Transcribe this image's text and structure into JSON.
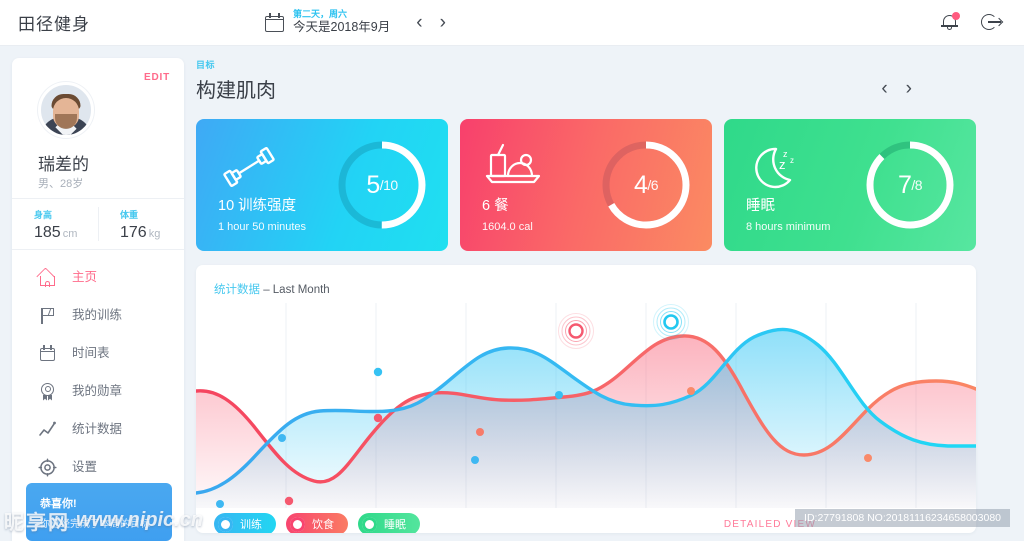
{
  "header": {
    "brand": "田径健身",
    "calendar_icon": "calendar-icon",
    "date_sub": "第二天，周六",
    "date_main": "今天是2018年9月",
    "prev": "‹",
    "next": "›",
    "bell_icon": "bell-icon",
    "logout_icon": "logout-icon"
  },
  "sidebar": {
    "edit_label": "EDIT",
    "user_name": "瑞差的",
    "user_meta": "男、28岁",
    "metrics": [
      {
        "label": "身高",
        "value": "185",
        "unit": "cm"
      },
      {
        "label": "体重",
        "value": "176",
        "unit": "kg"
      }
    ],
    "nav": [
      {
        "label": "主页",
        "icon": "home-icon",
        "active": true
      },
      {
        "label": "我的训练",
        "icon": "flag-icon",
        "active": false
      },
      {
        "label": "时间表",
        "icon": "calendar-icon",
        "active": false
      },
      {
        "label": "我的勋章",
        "icon": "medal-icon",
        "active": false
      },
      {
        "label": "统计数据",
        "icon": "line-chart-icon",
        "active": false
      },
      {
        "label": "设置",
        "icon": "gear-icon",
        "active": false
      }
    ],
    "promo": {
      "title": "恭喜你!",
      "sub": "你已经完成了本周的目标"
    }
  },
  "main": {
    "goal_kicker": "目标",
    "goal_title": "构建肌肉",
    "prev": "‹",
    "next": "›",
    "cards": [
      {
        "icon": "dumbbell-icon",
        "title": "10 训练强度",
        "subtitle": "1 hour 50 minutes",
        "value": "5",
        "total": "/10",
        "progress": 0.5,
        "color": "#22d3f5"
      },
      {
        "icon": "meal-icon",
        "title": "6 餐",
        "subtitle": "1604.0 cal",
        "value": "4",
        "total": "/6",
        "progress": 0.667,
        "color": "#fa6a67"
      },
      {
        "icon": "moon-sleep-icon",
        "title": "睡眠",
        "subtitle": "8 hours minimum",
        "value": "7",
        "total": "/8",
        "progress": 0.875,
        "color": "#3fe08f"
      }
    ]
  },
  "panel": {
    "title_hi": "统计数据",
    "title_rest": " – Last Month",
    "detailed_view": "DETAILED VIEW",
    "legend": [
      {
        "label": "训练",
        "color": "#37b6f2"
      },
      {
        "label": "饮食",
        "color": "#f8456f"
      },
      {
        "label": "睡眠",
        "color": "#2fd98a"
      }
    ]
  },
  "chart_data": {
    "type": "area",
    "title": "统计数据 – Last Month",
    "xlabel": "",
    "ylabel": "",
    "grid": "vertical",
    "legend_position": "bottom-left",
    "x": [
      0,
      1,
      2,
      3,
      4,
      5,
      6,
      7,
      8,
      9,
      10
    ],
    "ylim": [
      0,
      100
    ],
    "series": [
      {
        "name": "训练",
        "color": "#37b6f2",
        "values": [
          8,
          30,
          45,
          44,
          70,
          78,
          60,
          40,
          44,
          62,
          96,
          42,
          28
        ]
      },
      {
        "name": "饮食",
        "color": "#f8456f",
        "values": [
          55,
          40,
          12,
          14,
          34,
          58,
          62,
          60,
          56,
          52,
          80,
          24,
          20
        ]
      }
    ],
    "markers": [
      {
        "series": "训练",
        "x": 1.0,
        "y": 46
      },
      {
        "series": "训练",
        "x": 2.4,
        "y": 72
      },
      {
        "series": "训练",
        "x": 4.1,
        "y": 36
      },
      {
        "series": "训练",
        "x": 5.4,
        "y": 56
      },
      {
        "series": "训练",
        "x": 6.4,
        "y": 40
      },
      {
        "series": "饮食",
        "x": 1.1,
        "y": 10
      },
      {
        "series": "饮食",
        "x": 2.4,
        "y": 58
      },
      {
        "series": "饮食",
        "x": 4.2,
        "y": 50
      },
      {
        "series": "饮食",
        "x": 6.9,
        "y": 54
      },
      {
        "series": "饮食",
        "x": 7.4,
        "y": 24
      }
    ],
    "highlights": [
      {
        "series": "饮食",
        "x": 5.2,
        "y": 92,
        "color": "#f8456f"
      },
      {
        "series": "训练",
        "x": 6.5,
        "y": 96,
        "color": "#22c8f0"
      }
    ]
  },
  "watermark": {
    "left_cn": "昵享网",
    "left_url": "www.nipic.cn",
    "right": "ID:27791808 NO:20181116234658003080"
  }
}
